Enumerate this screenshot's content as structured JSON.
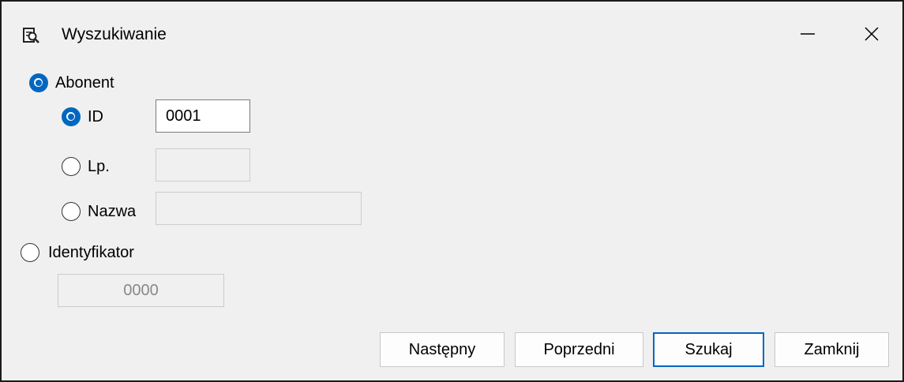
{
  "window": {
    "title": "Wyszukiwanie",
    "icon": "search-document-icon",
    "controls": {
      "minimize": "minimize-icon",
      "close": "close-icon"
    }
  },
  "search": {
    "abonent": {
      "label": "Abonent",
      "checked": true
    },
    "id": {
      "label": "ID",
      "checked": true,
      "value": "0001"
    },
    "lp": {
      "label": "Lp.",
      "checked": false,
      "value": ""
    },
    "nazwa": {
      "label": "Nazwa",
      "checked": false,
      "value": ""
    },
    "identyfikator": {
      "label": "Identyfikator",
      "checked": false,
      "value": "0000"
    }
  },
  "buttons": {
    "next": "Następny",
    "previous": "Poprzedni",
    "search": "Szukaj",
    "close": "Zamknij"
  },
  "colors": {
    "accent": "#0067c0",
    "window_bg": "#f0f0f0"
  }
}
